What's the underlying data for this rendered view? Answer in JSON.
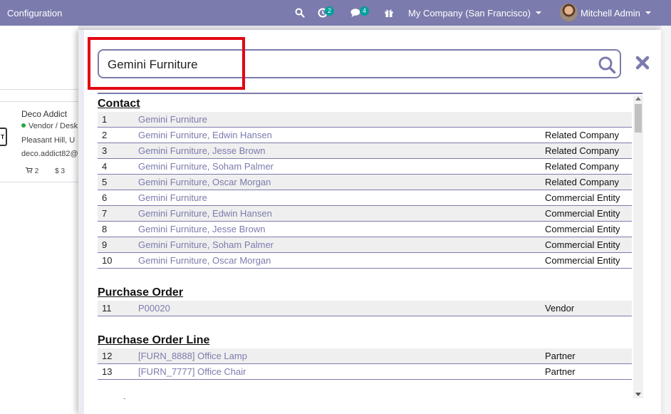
{
  "navbar": {
    "brand": "Configuration",
    "activity_count": "2",
    "message_count": "4",
    "company": "My Company (San Francisco)",
    "user": "Mitchell Admin"
  },
  "background_card": {
    "name": "Deco Addict",
    "tag": "Vendor / Desk",
    "city": "Pleasant Hill, U",
    "email": "deco.addict82@",
    "orders": "2",
    "invoices": "3",
    "logo_text": "T"
  },
  "search": {
    "value": "Gemini Furniture",
    "placeholder": ""
  },
  "sections": [
    {
      "title": "Contact",
      "rows": [
        {
          "num": "1",
          "name": "Gemini Furniture",
          "relation": ""
        },
        {
          "num": "2",
          "name": "Gemini Furniture, Edwin Hansen",
          "relation": "Related Company"
        },
        {
          "num": "3",
          "name": "Gemini Furniture, Jesse Brown",
          "relation": "Related Company"
        },
        {
          "num": "4",
          "name": "Gemini Furniture, Soham Palmer",
          "relation": "Related Company"
        },
        {
          "num": "5",
          "name": "Gemini Furniture, Oscar Morgan",
          "relation": "Related Company"
        },
        {
          "num": "6",
          "name": "Gemini Furniture",
          "relation": "Commercial Entity"
        },
        {
          "num": "7",
          "name": "Gemini Furniture, Edwin Hansen",
          "relation": "Commercial Entity"
        },
        {
          "num": "8",
          "name": "Gemini Furniture, Jesse Brown",
          "relation": "Commercial Entity"
        },
        {
          "num": "9",
          "name": "Gemini Furniture, Soham Palmer",
          "relation": "Commercial Entity"
        },
        {
          "num": "10",
          "name": "Gemini Furniture, Oscar Morgan",
          "relation": "Commercial Entity"
        }
      ]
    },
    {
      "title": "Purchase Order",
      "rows": [
        {
          "num": "11",
          "name": "P00020",
          "relation": "Vendor"
        }
      ]
    },
    {
      "title": "Purchase Order Line",
      "rows": [
        {
          "num": "12",
          "name": "[FURN_8888] Office Lamp",
          "relation": "Partner"
        },
        {
          "num": "13",
          "name": "[FURN_7777] Office Chair",
          "relation": "Partner"
        }
      ]
    },
    {
      "title": "Purchase Report",
      "rows": []
    }
  ],
  "colors": {
    "brand": "#7c7bad",
    "highlight": "#e30613",
    "badge": "#00a09d"
  },
  "icons": [
    "search-icon",
    "activity-icon",
    "chat-icon",
    "gift-icon",
    "close-icon",
    "cart-icon",
    "dollar-icon"
  ]
}
